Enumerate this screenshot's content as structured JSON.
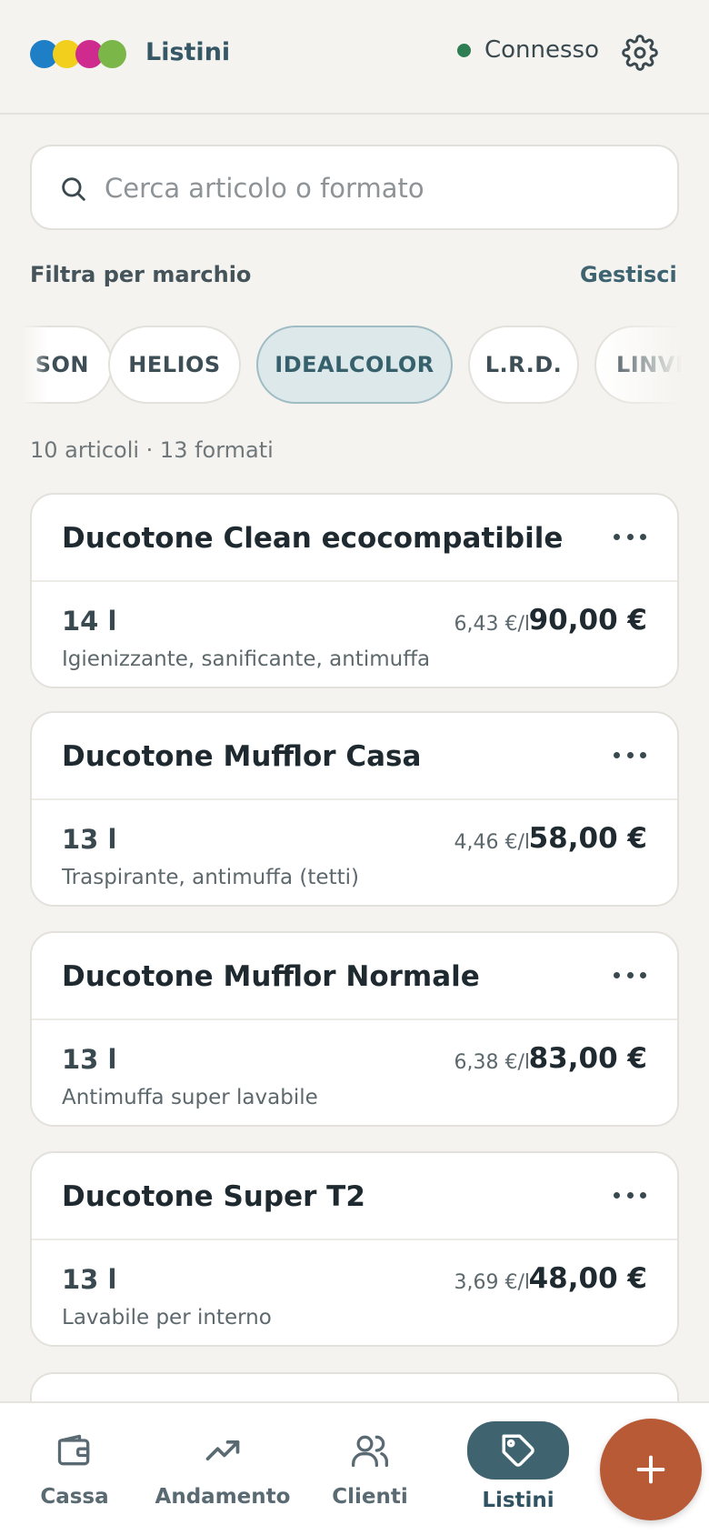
{
  "colors": {
    "logo": [
      "#1f7fc6",
      "#f2cf1d",
      "#cf2a8e",
      "#7ab648"
    ],
    "status_dot": "#2f7d52",
    "accent": "#3f6470",
    "fab": "#b85a36"
  },
  "header": {
    "title": "Listini",
    "status": "Connesso"
  },
  "search": {
    "placeholder": "Cerca articolo o formato"
  },
  "filter": {
    "label": "Filtra per marchio",
    "manage": "Gestisci",
    "brands": [
      "SON",
      "HELIOS",
      "IDEALCOLOR",
      "L.R.D.",
      "LINVE"
    ],
    "selected": "IDEALCOLOR"
  },
  "summary": "10 articoli · 13 formati",
  "items": [
    {
      "name": "Ducotone Clean ecocompatibile",
      "qty": "14 l",
      "desc": "Igienizzante, sanificante, antimuffa",
      "unit_price": "6,43 €/l",
      "price": "90,00 €"
    },
    {
      "name": "Ducotone Mufflor Casa",
      "qty": "13 l",
      "desc": "Traspirante, antimuffa (tetti)",
      "unit_price": "4,46 €/l",
      "price": "58,00 €"
    },
    {
      "name": "Ducotone Mufflor Normale",
      "qty": "13 l",
      "desc": "Antimuffa super lavabile",
      "unit_price": "6,38 €/l",
      "price": "83,00 €"
    },
    {
      "name": "Ducotone Super T2",
      "qty": "13 l",
      "desc": "Lavabile per interno",
      "unit_price": "3,69 €/l",
      "price": "48,00 €"
    }
  ],
  "nav": {
    "items": [
      {
        "label": "Cassa",
        "icon": "wallet-icon"
      },
      {
        "label": "Andamento",
        "icon": "trend-up-icon"
      },
      {
        "label": "Clienti",
        "icon": "users-icon"
      },
      {
        "label": "Listini",
        "icon": "tag-icon"
      }
    ],
    "active": "Listini",
    "fab_icon": "plus-icon"
  }
}
